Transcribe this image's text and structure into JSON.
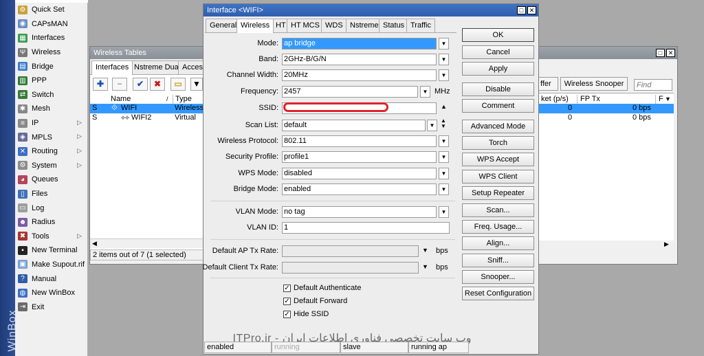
{
  "brand": "WinBox",
  "menu": [
    {
      "label": "Quick Set",
      "icon": "quick-set-icon",
      "color": "#c8a23a",
      "glyph": "⚙",
      "sub": false
    },
    {
      "label": "CAPsMAN",
      "icon": "capsman-icon",
      "color": "#6b8fc2",
      "glyph": "◉",
      "sub": false
    },
    {
      "label": "Interfaces",
      "icon": "interfaces-icon",
      "color": "#3b9c4e",
      "glyph": "▦",
      "sub": false
    },
    {
      "label": "Wireless",
      "icon": "wireless-icon",
      "color": "#777777",
      "glyph": "Ψ",
      "sub": false
    },
    {
      "label": "Bridge",
      "icon": "bridge-icon",
      "color": "#3a7ec8",
      "glyph": "▤",
      "sub": false
    },
    {
      "label": "PPP",
      "icon": "ppp-icon",
      "color": "#2f7b36",
      "glyph": "▥",
      "sub": false
    },
    {
      "label": "Switch",
      "icon": "switch-icon",
      "color": "#3b7c3b",
      "glyph": "⇄",
      "sub": false
    },
    {
      "label": "Mesh",
      "icon": "mesh-icon",
      "color": "#888888",
      "glyph": "✱",
      "sub": false
    },
    {
      "label": "IP",
      "icon": "ip-icon",
      "color": "#8a8a8a",
      "glyph": "≡",
      "sub": true
    },
    {
      "label": "MPLS",
      "icon": "mpls-icon",
      "color": "#6a6a9a",
      "glyph": "◈",
      "sub": true
    },
    {
      "label": "Routing",
      "icon": "routing-icon",
      "color": "#3d6fc4",
      "glyph": "✕",
      "sub": true
    },
    {
      "label": "System",
      "icon": "system-icon",
      "color": "#8d8d8d",
      "glyph": "⚙",
      "sub": true
    },
    {
      "label": "Queues",
      "icon": "queues-icon",
      "color": "#b4455a",
      "glyph": "◕",
      "sub": false
    },
    {
      "label": "Files",
      "icon": "files-icon",
      "color": "#3f73b9",
      "glyph": "▯",
      "sub": false
    },
    {
      "label": "Log",
      "icon": "log-icon",
      "color": "#9e9e9e",
      "glyph": "▭",
      "sub": false
    },
    {
      "label": "Radius",
      "icon": "radius-icon",
      "color": "#7d5aa8",
      "glyph": "☻",
      "sub": false
    },
    {
      "label": "Tools",
      "icon": "tools-icon",
      "color": "#a8352f",
      "glyph": "✖",
      "sub": true
    },
    {
      "label": "New Terminal",
      "icon": "terminal-icon",
      "color": "#222222",
      "glyph": "▪",
      "sub": false
    },
    {
      "label": "Make Supout.rif",
      "icon": "supout-icon",
      "color": "#7a9fd0",
      "glyph": "▣",
      "sub": false
    },
    {
      "label": "Manual",
      "icon": "manual-icon",
      "color": "#2e5fa8",
      "glyph": "?",
      "sub": false
    },
    {
      "label": "New WinBox",
      "icon": "winbox-icon",
      "color": "#3d6fc4",
      "glyph": "◍",
      "sub": false
    },
    {
      "label": "Exit",
      "icon": "exit-icon",
      "color": "#6a6a6a",
      "glyph": "⇥",
      "sub": false
    }
  ],
  "wireless_tables": {
    "title": "Wireless Tables",
    "tabs": [
      "Interfaces",
      "Nstreme Dual",
      "Access"
    ],
    "columns": [
      "Name",
      "Type"
    ],
    "rows": [
      {
        "flag": "S",
        "name": "WIFI",
        "type": "Wireless"
      },
      {
        "flag": "S",
        "name": "WIFI2",
        "type": "Virtual"
      }
    ],
    "status": "2 items out of 7 (1 selected)",
    "right_buttons": [
      "ffer",
      "Wireless Snooper"
    ],
    "find_placeholder": "Find",
    "right_columns": [
      "ket (p/s)",
      "FP Tx",
      "F"
    ],
    "right_rows": [
      {
        "packets": "0",
        "fptx": "0 bps"
      },
      {
        "packets": "0",
        "fptx": "0 bps"
      }
    ]
  },
  "dialog": {
    "title": "Interface <WIFI>",
    "tabs": [
      "General",
      "Wireless",
      "HT",
      "HT MCS",
      "WDS",
      "Nstreme",
      "Status",
      "Traffic"
    ],
    "fields": {
      "mode": {
        "label": "Mode:",
        "value": "ap bridge"
      },
      "band": {
        "label": "Band:",
        "value": "2GHz-B/G/N"
      },
      "channel_width": {
        "label": "Channel Width:",
        "value": "20MHz"
      },
      "frequency": {
        "label": "Frequency:",
        "value": "2457",
        "unit": "MHz"
      },
      "ssid": {
        "label": "SSID:",
        "value": ""
      },
      "scan_list": {
        "label": "Scan List:",
        "value": "default"
      },
      "wireless_protocol": {
        "label": "Wireless Protocol:",
        "value": "802.11"
      },
      "security_profile": {
        "label": "Security Profile:",
        "value": "profile1"
      },
      "wps_mode": {
        "label": "WPS Mode:",
        "value": "disabled"
      },
      "bridge_mode": {
        "label": "Bridge Mode:",
        "value": "enabled"
      },
      "vlan_mode": {
        "label": "VLAN Mode:",
        "value": "no tag"
      },
      "vlan_id": {
        "label": "VLAN ID:",
        "value": "1"
      },
      "default_ap_tx_rate": {
        "label": "Default AP Tx Rate:",
        "value": "",
        "unit": "bps"
      },
      "default_client_tx_rate": {
        "label": "Default Client Tx Rate:",
        "value": "",
        "unit": "bps"
      }
    },
    "checkboxes": [
      {
        "label": "Default Authenticate",
        "checked": true
      },
      {
        "label": "Default Forward",
        "checked": true
      },
      {
        "label": "Hide SSID",
        "checked": true
      }
    ],
    "buttons": [
      "OK",
      "Cancel",
      "Apply",
      "Disable",
      "Comment",
      "Advanced Mode",
      "Torch",
      "WPS Accept",
      "WPS Client",
      "Setup Repeater",
      "Scan...",
      "Freq. Usage...",
      "Align...",
      "Sniff...",
      "Snooper...",
      "Reset Configuration"
    ],
    "status_bar": [
      "enabled",
      "running",
      "slave",
      "running ap"
    ],
    "watermark": "ITPro.ir - وب سایت تخصصی فناوری اطلاعات ایران"
  },
  "colors": {
    "selection": "#3399ff",
    "ssid_highlight": "#e0222a",
    "titlebar": "#9ea4aa"
  }
}
